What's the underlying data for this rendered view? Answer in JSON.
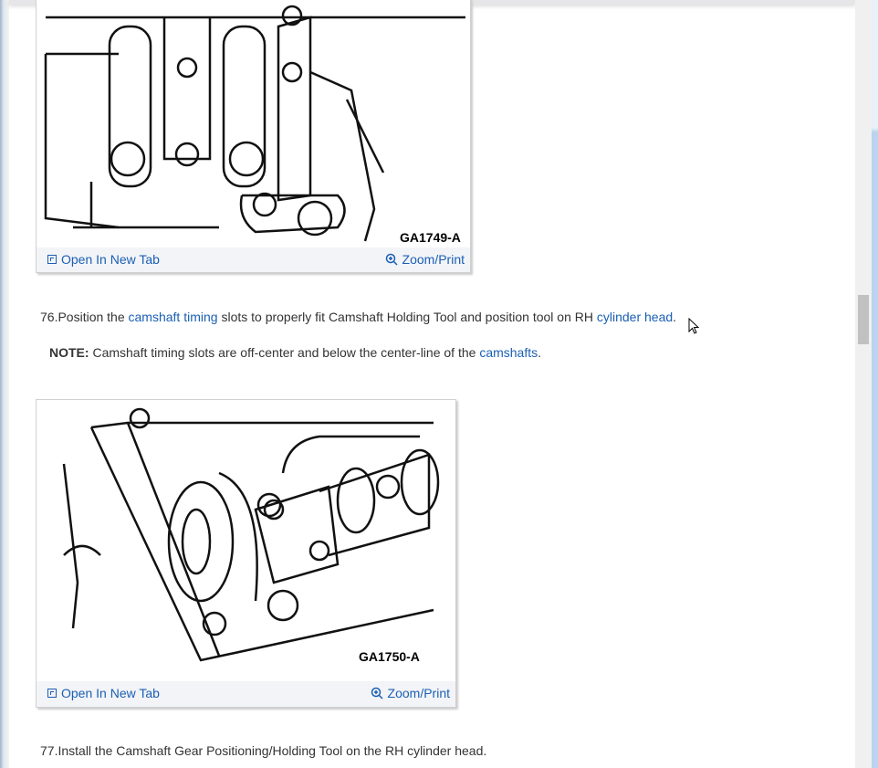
{
  "figures": [
    {
      "code": "GA1749-A",
      "open_label": "Open In New Tab",
      "zoom_label": "Zoom/Print"
    },
    {
      "code": "GA1750-A",
      "open_label": "Open In New Tab",
      "zoom_label": "Zoom/Print"
    }
  ],
  "step76": {
    "prefix": "76.Position the ",
    "link1": "camshaft timing",
    "mid": " slots to properly fit Camshaft Holding Tool and position tool on RH ",
    "link2": "cylinder head",
    "suffix": "."
  },
  "note": {
    "label": "NOTE:",
    "text": " Camshaft timing slots are off-center and below the center-line of the ",
    "link": "camshafts",
    "suffix": "."
  },
  "step77": {
    "text": "77.Install the Camshaft Gear Positioning/Holding Tool on the RH cylinder head."
  },
  "colors": {
    "link": "#1a5fb4",
    "text": "#333333"
  }
}
